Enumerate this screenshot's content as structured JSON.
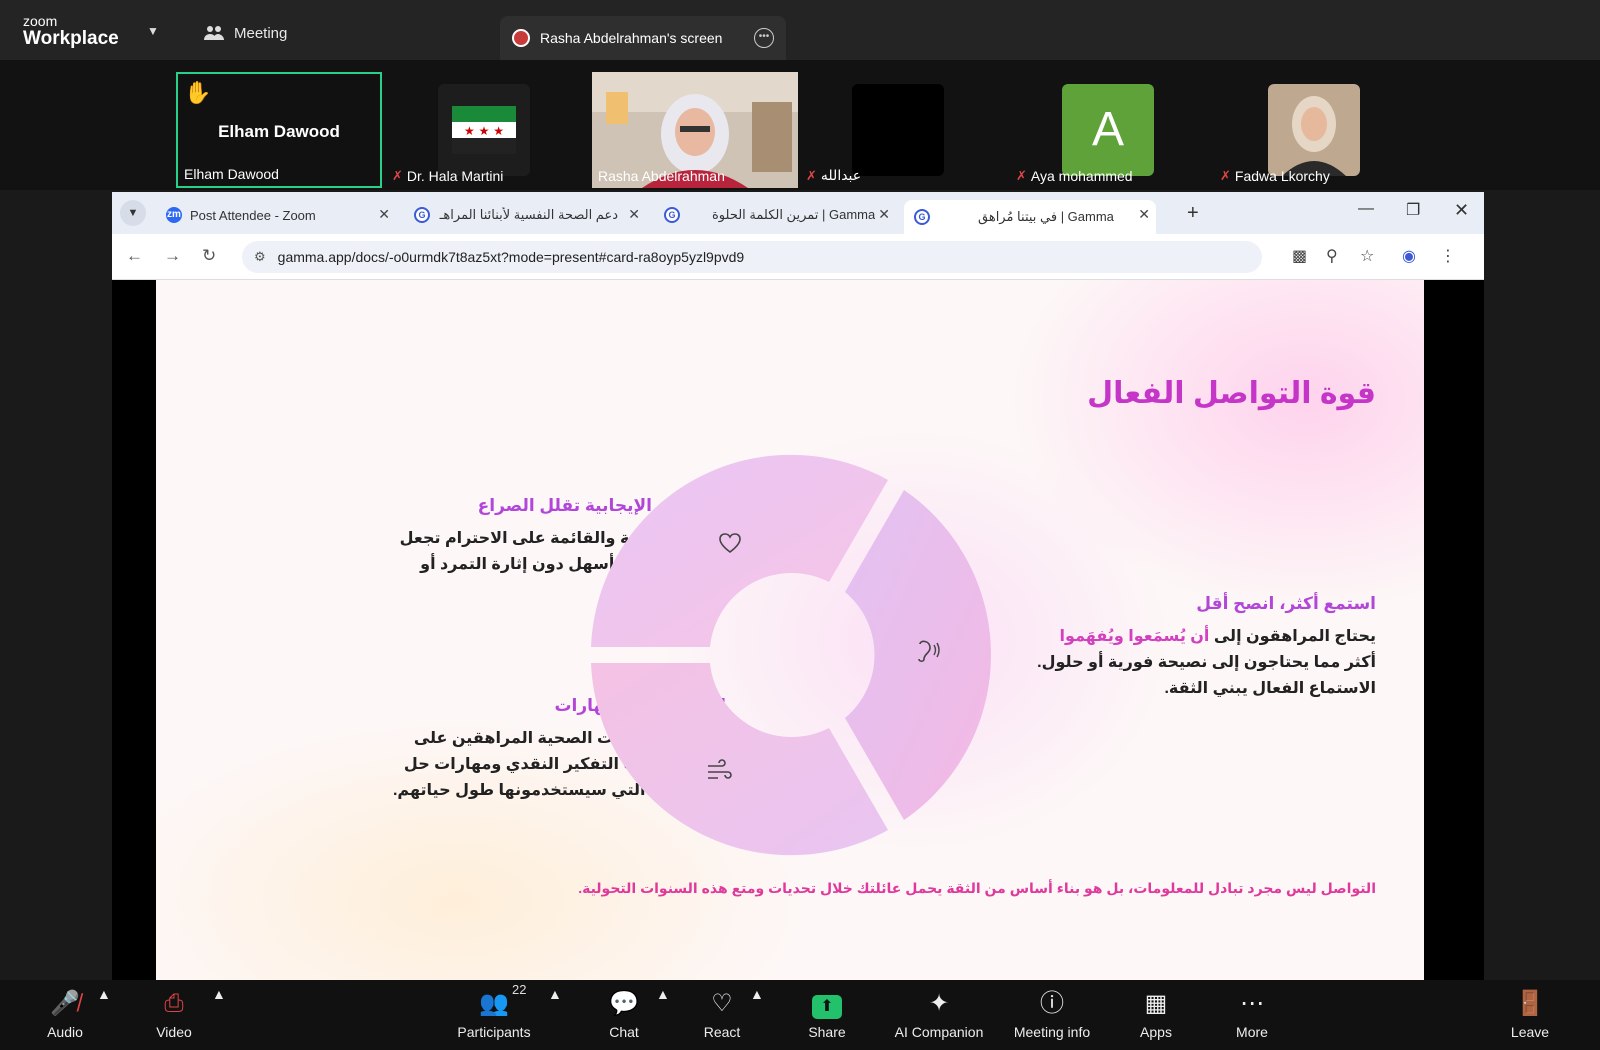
{
  "zoom": {
    "brand_small": "zoom",
    "brand_big": "Workplace",
    "meeting_label": "Meeting",
    "screen_share_label": "Rasha Abdelrahman's screen"
  },
  "participants_strip": [
    {
      "name": "Elham Dawood",
      "label": "Elham Dawood",
      "muted": false,
      "hand_raised": true
    },
    {
      "name": "Dr. Hala Martini",
      "muted": true
    },
    {
      "name": "Rasha Abdelrahman",
      "muted": false
    },
    {
      "name": "عبدالله",
      "muted": true
    },
    {
      "name": "Aya mohammed",
      "muted": true,
      "initial": "A"
    },
    {
      "name": "Fadwa Lkorchy",
      "muted": true
    }
  ],
  "browser": {
    "tabs": [
      {
        "title": "Post Attendee - Zoom",
        "icon": "zoom-icon"
      },
      {
        "title": "دعم الصحة النفسية لأبنائنا المراهـ",
        "icon": "gamma-icon"
      },
      {
        "title": "تمرين الكلمة الحلوة | Gamma",
        "icon": "gamma-icon"
      },
      {
        "title": "في بيتنا مُراهق | Gamma",
        "icon": "gamma-icon",
        "active": true
      }
    ],
    "url": "gamma.app/docs/-o0urmdk7t8az5xt?mode=present#card-ra8oyp5yzl9pvd9"
  },
  "slide": {
    "title": "قوة التواصل الفعال",
    "block_right": {
      "heading": "استمع أكثر، انصح أقل",
      "body_prefix": "يحتاج المراهقون إلى ",
      "body_highlight": "أن يُسمَعوا ويُفهَموا",
      "body_suffix": " أكثر مما يحتاجون إلى نصيحة فورية أو حلول. الاستماع الفعال يبني الثقة."
    },
    "block_top_left": {
      "heading": "العلاقات الإيجابية تقلل الصراع",
      "body": "العلاقة القوية والقائمة على الاحترام تجعل توجيه السلوك أسهل دون إثارة التمرد أو صراعات القوة."
    },
    "block_bottom_left": {
      "heading": "الحوار يبني المهارات",
      "body": "تساعد المحادثات الصحية المراهقين على تطوير قدرات التفكير النقدي ومهارات حل المشكلات التي سيستخدمونها طول حياتهم."
    },
    "footer": "التواصل ليس مجرد تبادل للمعلومات، بل هو بناء أساس من الثقة يحمل عائلتك خلال تحديات ومتع هذه السنوات التحولية.",
    "donut_icons": [
      "heart-icon",
      "ear-icon",
      "wind-icon"
    ]
  },
  "controls": {
    "audio": "Audio",
    "video": "Video",
    "participants": "Participants",
    "participants_count": "22",
    "chat": "Chat",
    "react": "React",
    "share": "Share",
    "ai_companion": "AI Companion",
    "meeting_info": "Meeting info",
    "apps": "Apps",
    "more": "More",
    "leave": "Leave"
  }
}
